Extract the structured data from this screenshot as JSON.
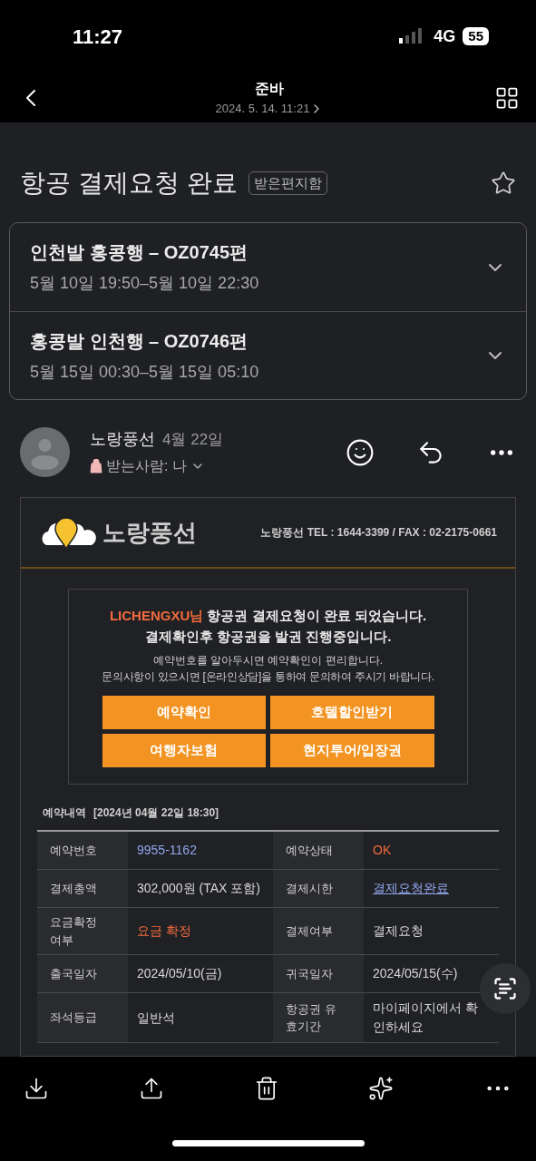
{
  "status_bar": {
    "time": "11:27",
    "network": "4G",
    "battery": "55"
  },
  "nav": {
    "title": "준바",
    "date": "2024. 5. 14. 11:21"
  },
  "subject": {
    "title": "항공 결제요청 완료",
    "folder": "받은편지함",
    "starred": false
  },
  "flights": [
    {
      "title": "인천발 홍콩행 – OZ0745편",
      "times": "5월 10일 19:50–5월 10일 22:30",
      "expanded": false
    },
    {
      "title": "홍콩발 인천행 – OZ0746편",
      "times": "5월 15일 00:30–5월 15일 05:10",
      "expanded": false
    }
  ],
  "sender": {
    "name": "노랑풍선",
    "date": "4월 22일",
    "recipient": "받는사람: 나"
  },
  "email": {
    "logo_text": "노랑풍선",
    "contact": "노랑풍선 TEL : 1644-3399 / FAX : 02-2175-0661",
    "notice": {
      "customer": "LICHENGXU님",
      "line_1": "항공권 결제요청이 완료 되었습니다.",
      "line_2": "결제확인후 항공권을 발권 진행중입니다.",
      "line_3": "예약번호를 알아두시면 예약확인이 편리합니다.",
      "line_4": "문의사항이 있으시면 [온라인상담]을 통하여 문의하여 주시기 바랍니다."
    },
    "buttons": [
      "예약확인",
      "호텔할인받기",
      "여행자보험",
      "현지투어/입장권"
    ],
    "reservation": {
      "heading": "예약내역",
      "timestamp": "[2024년 04월 22일 18:30]",
      "rows": [
        {
          "cells": [
            {
              "label": "예약번호",
              "value": "9955-1162",
              "kind": "text",
              "color": "#8fa6ec"
            },
            {
              "label": "예약상태",
              "value": "OK",
              "kind": "text",
              "color": "#f26a3d"
            }
          ]
        },
        {
          "cells": [
            {
              "label": "결제총액",
              "value": "302,000원 (TAX 포함)",
              "kind": "text",
              "color": "#d8d8d8"
            },
            {
              "label": "결제시한",
              "value": "결제요청완료",
              "kind": "link",
              "color": "#8fa6ec"
            }
          ]
        },
        {
          "cells": [
            {
              "label": "요금확정 여부",
              "value": "요금 확정",
              "kind": "text",
              "color": "#f26a3d"
            },
            {
              "label": "결제여부",
              "value": "결제요청",
              "kind": "text",
              "color": "#d8d8d8"
            }
          ]
        },
        {
          "cells": [
            {
              "label": "출국일자",
              "value": "2024/05/10(금)",
              "kind": "text",
              "color": "#d8d8d8"
            },
            {
              "label": "귀국일자",
              "value": "2024/05/15(수)",
              "kind": "text",
              "color": "#d8d8d8"
            }
          ]
        },
        {
          "cells": [
            {
              "label": "좌석등급",
              "value": "일반석",
              "kind": "text",
              "color": "#d8d8d8"
            },
            {
              "label": "항공권 유효기간",
              "value": "마이페이지에서 확인하세요",
              "kind": "text",
              "color": "#d8d8d8"
            }
          ]
        }
      ]
    }
  }
}
